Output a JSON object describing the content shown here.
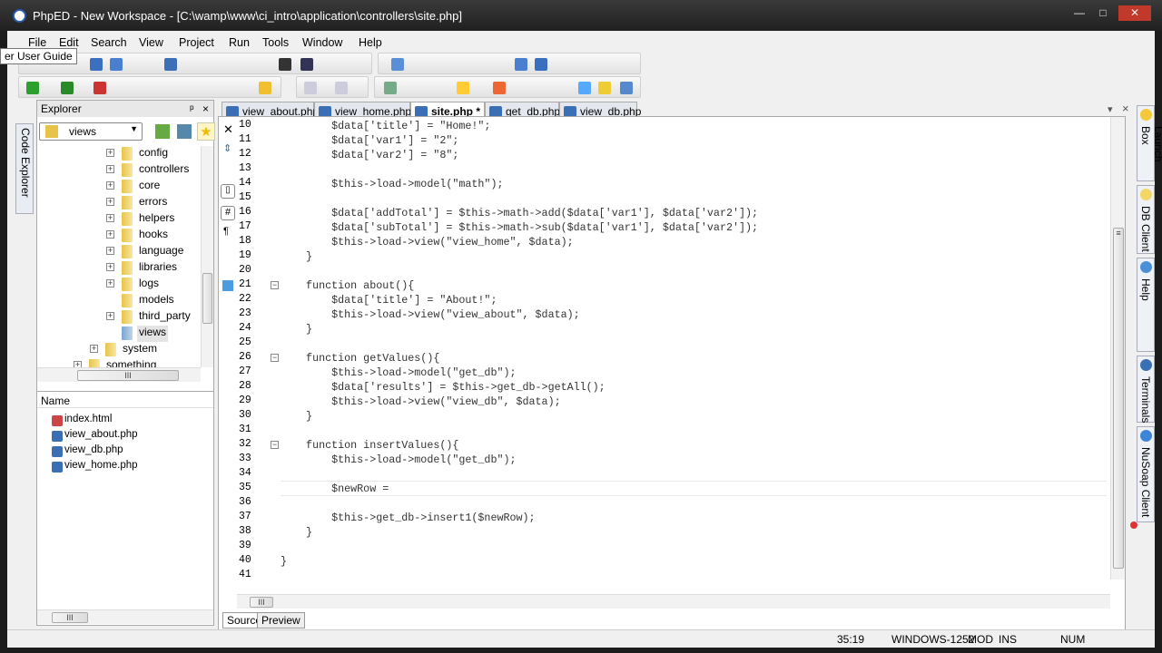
{
  "window": {
    "title": "PhpED - New Workspace - [C:\\wamp\\www\\ci_intro\\application\\controllers\\site.php]",
    "minimize": "—",
    "maximize": "□",
    "close": "✕"
  },
  "menu": [
    "File",
    "Edit",
    "Search",
    "View",
    "Project",
    "Run",
    "Tools",
    "Window",
    "Help"
  ],
  "tooltip": "er User Guide",
  "explorer": {
    "title": "Explorer",
    "pin": "ᵖ",
    "close": "×",
    "combo": "views",
    "side_tab": "Code Explorer",
    "tree": [
      {
        "label": "config",
        "expand": true
      },
      {
        "label": "controllers",
        "expand": true
      },
      {
        "label": "core",
        "expand": true
      },
      {
        "label": "errors",
        "expand": true
      },
      {
        "label": "helpers",
        "expand": true
      },
      {
        "label": "hooks",
        "expand": true
      },
      {
        "label": "language",
        "expand": true
      },
      {
        "label": "libraries",
        "expand": true
      },
      {
        "label": "logs",
        "expand": true
      },
      {
        "label": "models",
        "expand": false
      },
      {
        "label": "third_party",
        "expand": true
      },
      {
        "label": "views",
        "expand": false,
        "selected": true
      },
      {
        "label": "system",
        "expand": true,
        "level": 1
      },
      {
        "label": "something",
        "expand": true,
        "level": 0
      }
    ],
    "files_header": "Name",
    "files": [
      "index.html",
      "view_about.php",
      "view_db.php",
      "view_home.php"
    ]
  },
  "tabs": [
    {
      "label": "view_about.php"
    },
    {
      "label": "view_home.php"
    },
    {
      "label": "site.php *",
      "active": true
    },
    {
      "label": "get_db.php"
    },
    {
      "label": "view_db.php"
    }
  ],
  "editor": {
    "first_line": 10,
    "current_line": 35,
    "folds": [
      21,
      26,
      32
    ],
    "lines": [
      "        $data['title'] = \"Home!\";",
      "        $data['var1'] = \"2\";",
      "        $data['var2'] = \"8\";",
      "",
      "        $this->load->model(\"math\");",
      "",
      "        $data['addTotal'] = $this->math->add($data['var1'], $data['var2']);",
      "        $data['subTotal'] = $this->math->sub($data['var1'], $data['var2']);",
      "        $this->load->view(\"view_home\", $data);",
      "    }",
      "",
      "    function about(){",
      "        $data['title'] = \"About!\";",
      "        $this->load->view(\"view_about\", $data);",
      "    }",
      "",
      "    function getValues(){",
      "        $this->load->model(\"get_db\");",
      "        $data['results'] = $this->get_db->getAll();",
      "        $this->load->view(\"view_db\", $data);",
      "    }",
      "",
      "    function insertValues(){",
      "        $this->load->model(\"get_db\");",
      "",
      "        $newRow = ",
      "",
      "        $this->get_db->insert1($newRow);",
      "    }",
      "",
      "}",
      ""
    ]
  },
  "bottom_tabs": [
    "Source",
    "Preview"
  ],
  "right_tabs": [
    "Launch Box",
    "DB Client",
    "Help",
    "Terminals",
    "NuSoap Client"
  ],
  "status": {
    "position": "35:19",
    "encoding": "WINDOWS-1252",
    "mod": "MOD",
    "ins": "INS",
    "num": "NUM"
  }
}
